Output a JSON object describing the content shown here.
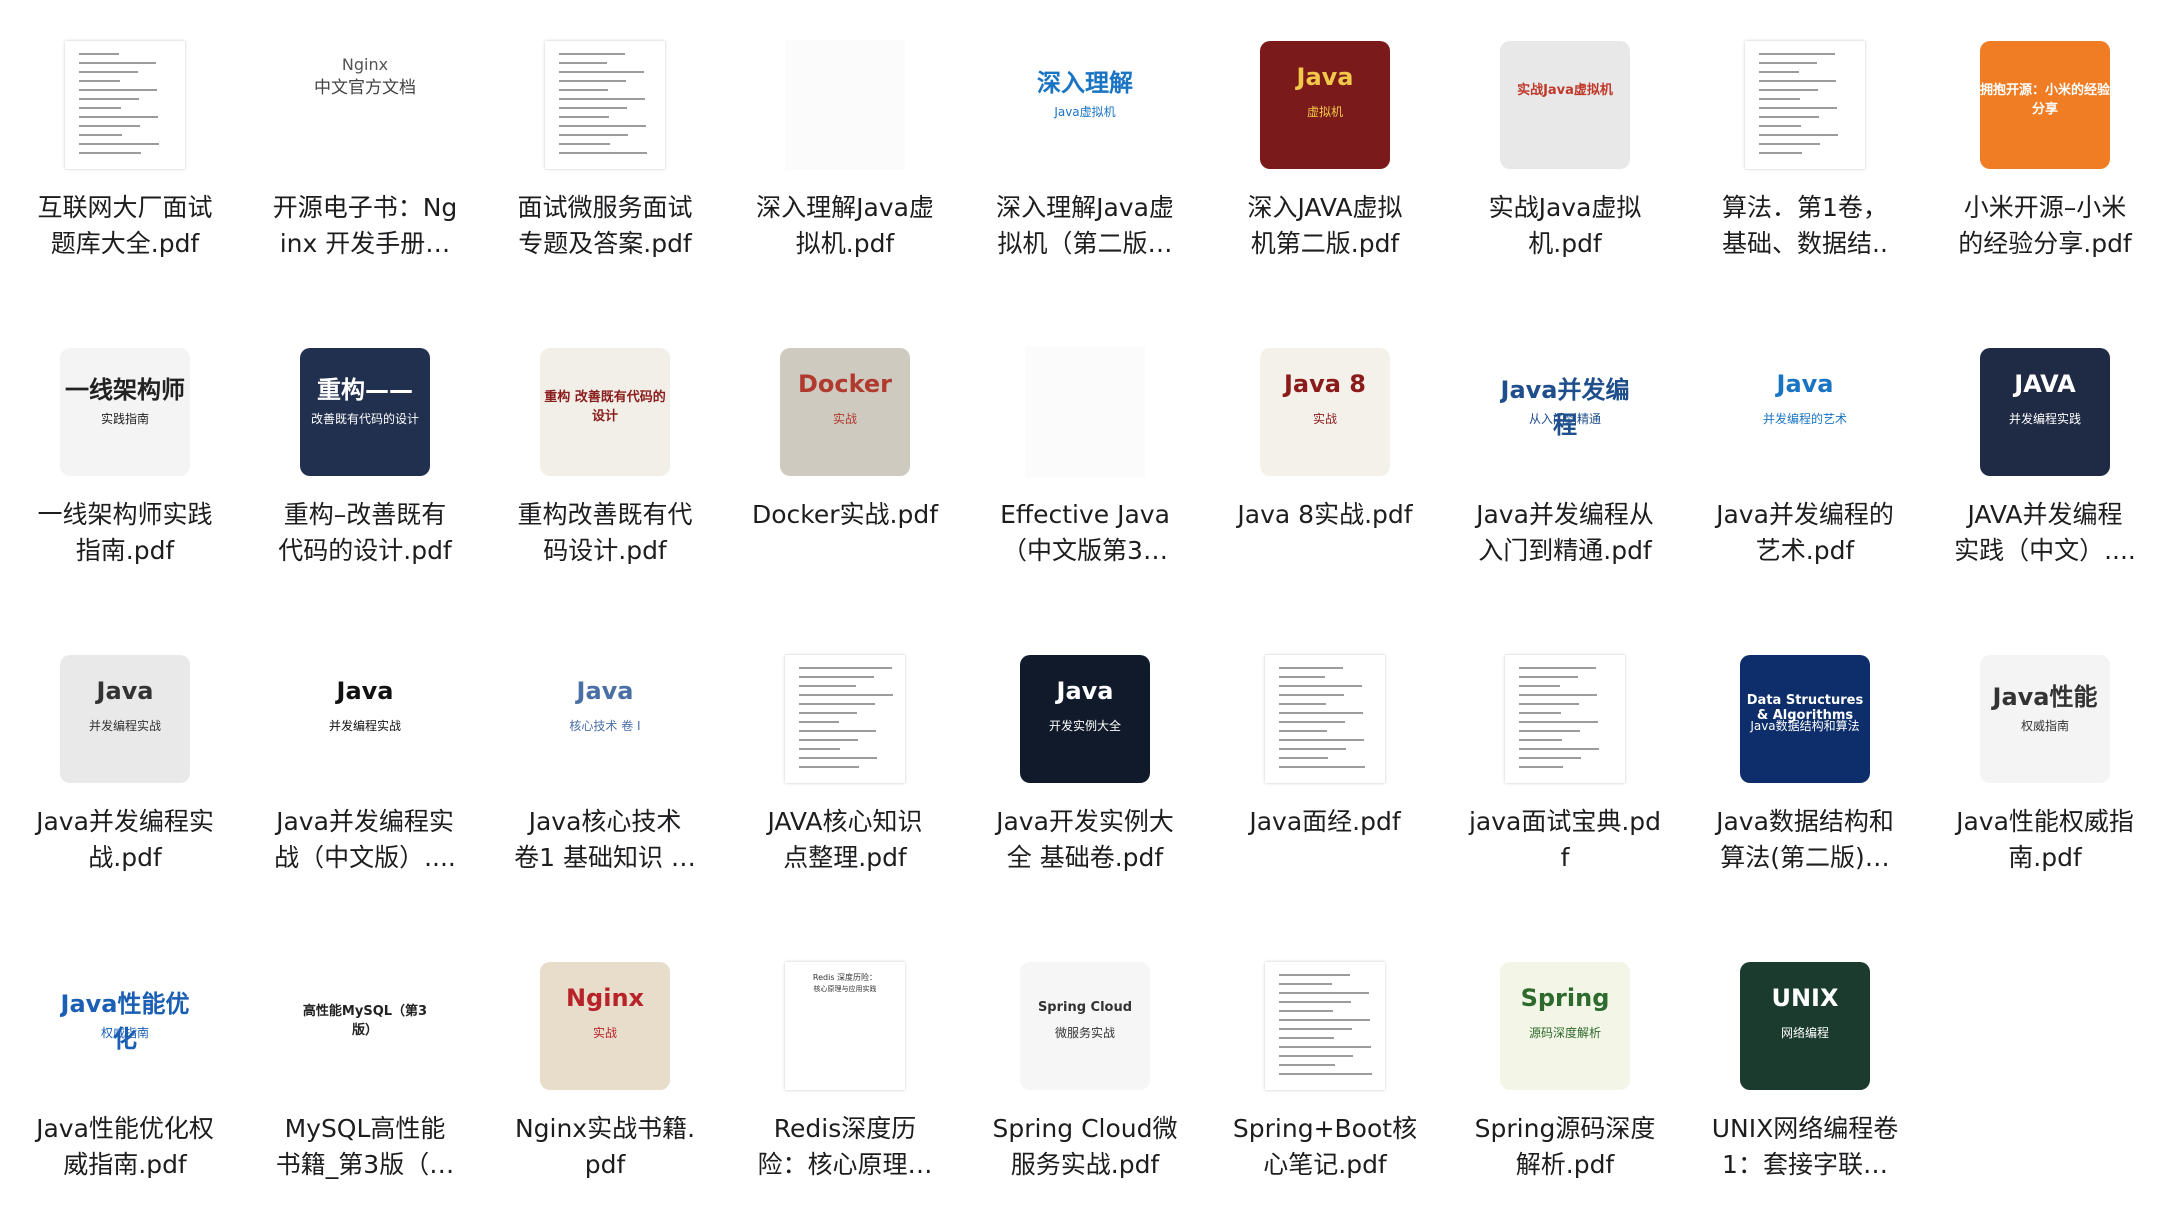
{
  "files": [
    {
      "row": 0,
      "col": 0,
      "line1": "互联网大厂面试",
      "line2": "题库大全.pdf",
      "thumb": "page",
      "icon": "pdf-document-icon"
    },
    {
      "row": 0,
      "col": 1,
      "line1": "开源电子书：Ng",
      "line2": "inx 开发手册…",
      "thumb": "nginx",
      "icon": "pdf-document-icon",
      "cover_text": "Nginx",
      "cover_sub": "中文官方文档"
    },
    {
      "row": 0,
      "col": 2,
      "line1": "面试微服务面试",
      "line2": "专题及答案.pdf",
      "thumb": "page",
      "icon": "pdf-document-icon"
    },
    {
      "row": 0,
      "col": 3,
      "line1": "深入理解Java虚",
      "line2": "拟机.pdf",
      "thumb": "blank",
      "icon": "pdf-document-icon"
    },
    {
      "row": 0,
      "col": 4,
      "line1": "深入理解Java虚",
      "line2": "拟机（第二版…",
      "thumb": "cover",
      "icon": "book-cover-icon",
      "cover_text": "深入理解",
      "cover_sub": "Java虚拟机",
      "bg": "#ffffff",
      "fg": "#1a74c4"
    },
    {
      "row": 0,
      "col": 5,
      "line1": "深入JAVA虚拟",
      "line2": "机第二版.pdf",
      "thumb": "cover",
      "icon": "book-cover-icon",
      "cover_text": "Java",
      "cover_sub": "虚拟机",
      "bg": "#7a1a1a",
      "fg": "#f2c84a"
    },
    {
      "row": 0,
      "col": 6,
      "line1": "实战Java虚拟",
      "line2": "机.pdf",
      "thumb": "cover",
      "icon": "book-cover-icon",
      "cover_text": "实战Java虚拟机",
      "cover_sub": "",
      "bg": "#e8e8e8",
      "fg": "#c0392b"
    },
    {
      "row": 0,
      "col": 7,
      "line1": "算法．第1卷，",
      "line2": "基础、数据结..",
      "thumb": "page",
      "icon": "pdf-document-icon"
    },
    {
      "row": 0,
      "col": 8,
      "line1": "小米开源–小米",
      "line2": "的经验分享.pdf",
      "thumb": "cover",
      "icon": "book-cover-icon",
      "cover_text": "拥抱开源：小米的经验分享",
      "cover_sub": "",
      "bg": "#f07c23",
      "fg": "#ffffff"
    },
    {
      "row": 1,
      "col": 0,
      "line1": "一线架构师实践",
      "line2": "指南.pdf",
      "thumb": "cover",
      "icon": "book-cover-icon",
      "cover_text": "一线架构师",
      "cover_sub": "实践指南",
      "bg": "#f4f4f4",
      "fg": "#222222"
    },
    {
      "row": 1,
      "col": 1,
      "line1": "重构–改善既有",
      "line2": "代码的设计.pdf",
      "thumb": "cover",
      "icon": "book-cover-icon",
      "cover_text": "重构——",
      "cover_sub": "改善既有代码的设计",
      "bg": "#22304f",
      "fg": "#ffffff"
    },
    {
      "row": 1,
      "col": 2,
      "line1": "重构改善既有代",
      "line2": "码设计.pdf",
      "thumb": "cover",
      "icon": "book-cover-icon",
      "cover_text": "重构 改善既有代码的设计",
      "cover_sub": "",
      "bg": "#f2efe8",
      "fg": "#8a1d1d"
    },
    {
      "row": 1,
      "col": 3,
      "line1": "Docker实战.pdf",
      "line2": "",
      "thumb": "cover",
      "icon": "book-cover-icon",
      "cover_text": "Docker",
      "cover_sub": "实战",
      "bg": "#cfcac0",
      "fg": "#b03a2e"
    },
    {
      "row": 1,
      "col": 4,
      "line1": "Effective Java",
      "line2": "（中文版第3…",
      "thumb": "blank",
      "icon": "pdf-document-icon"
    },
    {
      "row": 1,
      "col": 5,
      "line1": "Java 8实战.pdf",
      "line2": "",
      "thumb": "cover",
      "icon": "book-cover-icon",
      "cover_text": "Java 8",
      "cover_sub": "实战",
      "bg": "#f4f1ea",
      "fg": "#8b1a1a"
    },
    {
      "row": 1,
      "col": 6,
      "line1": "Java并发编程从",
      "line2": "入门到精通.pdf",
      "thumb": "cover",
      "icon": "book-cover-icon",
      "cover_text": "Java并发编程",
      "cover_sub": "从入门到精通",
      "bg": "#ffffff",
      "fg": "#1e4e8c"
    },
    {
      "row": 1,
      "col": 7,
      "line1": "Java并发编程的",
      "line2": "艺术.pdf",
      "thumb": "cover",
      "icon": "book-cover-icon",
      "cover_text": "Java",
      "cover_sub": "并发编程的艺术",
      "bg": "#ffffff",
      "fg": "#1a74c4"
    },
    {
      "row": 1,
      "col": 8,
      "line1": "JAVA并发编程",
      "line2": "实践（中文）....",
      "thumb": "cover",
      "icon": "book-cover-icon",
      "cover_text": "JAVA",
      "cover_sub": "并发编程实践",
      "bg": "#1f2a44",
      "fg": "#ffffff"
    },
    {
      "row": 2,
      "col": 0,
      "line1": "Java并发编程实",
      "line2": "战.pdf",
      "thumb": "cover",
      "icon": "book-cover-icon",
      "cover_text": "Java",
      "cover_sub": "并发编程实战",
      "bg": "#e9e9e9",
      "fg": "#333333"
    },
    {
      "row": 2,
      "col": 1,
      "line1": "Java并发编程实",
      "line2": "战（中文版）....",
      "thumb": "cover",
      "icon": "book-cover-icon",
      "cover_text": "Java",
      "cover_sub": "并发编程实战",
      "bg": "#ffffff",
      "fg": "#111111"
    },
    {
      "row": 2,
      "col": 2,
      "line1": "Java核心技术",
      "line2": "卷1 基础知识 …",
      "thumb": "cover",
      "icon": "book-cover-icon",
      "cover_text": "Java",
      "cover_sub": "核心技术 卷 I",
      "bg": "#ffffff",
      "fg": "#4a6fa5"
    },
    {
      "row": 2,
      "col": 3,
      "line1": "JAVA核心知识",
      "line2": "点整理.pdf",
      "thumb": "page",
      "icon": "pdf-document-icon"
    },
    {
      "row": 2,
      "col": 4,
      "line1": "Java开发实例大",
      "line2": "全 基础卷.pdf",
      "thumb": "cover",
      "icon": "book-cover-icon",
      "cover_text": "Java",
      "cover_sub": "开发实例大全",
      "bg": "#101a2a",
      "fg": "#ffffff"
    },
    {
      "row": 2,
      "col": 5,
      "line1": "Java面经.pdf",
      "line2": "",
      "thumb": "page",
      "icon": "pdf-document-icon"
    },
    {
      "row": 2,
      "col": 6,
      "line1": "java面试宝典.pd",
      "line2": "f",
      "thumb": "page",
      "icon": "pdf-document-icon"
    },
    {
      "row": 2,
      "col": 7,
      "line1": "Java数据结构和",
      "line2": "算法(第二版)…",
      "thumb": "cover",
      "icon": "book-cover-icon",
      "cover_text": "Data Structures & Algorithms",
      "cover_sub": "Java数据结构和算法",
      "bg": "#0d2e6a",
      "fg": "#ffffff"
    },
    {
      "row": 2,
      "col": 8,
      "line1": "Java性能权威指",
      "line2": "南.pdf",
      "thumb": "cover",
      "icon": "book-cover-icon",
      "cover_text": "Java性能",
      "cover_sub": "权威指南",
      "bg": "#f4f4f4",
      "fg": "#333333"
    },
    {
      "row": 3,
      "col": 0,
      "line1": "Java性能优化权",
      "line2": "威指南.pdf",
      "thumb": "cover",
      "icon": "book-cover-icon",
      "cover_text": "Java性能优化",
      "cover_sub": "权威指南",
      "bg": "#ffffff",
      "fg": "#1a5fb4"
    },
    {
      "row": 3,
      "col": 1,
      "line1": "MySQL高性能",
      "line2": "书籍_第3版（…",
      "thumb": "cover",
      "icon": "book-cover-icon",
      "cover_text": "高性能MySQL（第3版）",
      "cover_sub": "",
      "bg": "#ffffff",
      "fg": "#222222"
    },
    {
      "row": 3,
      "col": 2,
      "line1": "Nginx实战书籍.",
      "line2": "pdf",
      "thumb": "cover",
      "icon": "book-cover-icon",
      "cover_text": "Nginx",
      "cover_sub": "实战",
      "bg": "#e8dccb",
      "fg": "#b8232a"
    },
    {
      "row": 3,
      "col": 3,
      "line1": "Redis深度历",
      "line2": "险：核心原理…",
      "thumb": "page",
      "icon": "pdf-document-icon",
      "cover_text": "Redis 深度历险：",
      "cover_sub": "核心原理与应用实践"
    },
    {
      "row": 3,
      "col": 4,
      "line1": "Spring Cloud微",
      "line2": "服务实战.pdf",
      "thumb": "cover",
      "icon": "book-cover-icon",
      "cover_text": "Spring Cloud",
      "cover_sub": "微服务实战",
      "bg": "#f6f6f6",
      "fg": "#333333"
    },
    {
      "row": 3,
      "col": 5,
      "line1": "Spring+Boot核",
      "line2": "心笔记.pdf",
      "thumb": "page",
      "icon": "pdf-document-icon"
    },
    {
      "row": 3,
      "col": 6,
      "line1": "Spring源码深度",
      "line2": "解析.pdf",
      "thumb": "cover",
      "icon": "book-cover-icon",
      "cover_text": "Spring",
      "cover_sub": "源码深度解析",
      "bg": "#f3f6e6",
      "fg": "#2d6a2d"
    },
    {
      "row": 3,
      "col": 7,
      "line1": "UNIX网络编程卷",
      "line2": "1：套接字联…",
      "thumb": "cover",
      "icon": "book-cover-icon",
      "cover_text": "UNIX",
      "cover_sub": "网络编程",
      "bg": "#1b3b2f",
      "fg": "#ffffff"
    }
  ]
}
